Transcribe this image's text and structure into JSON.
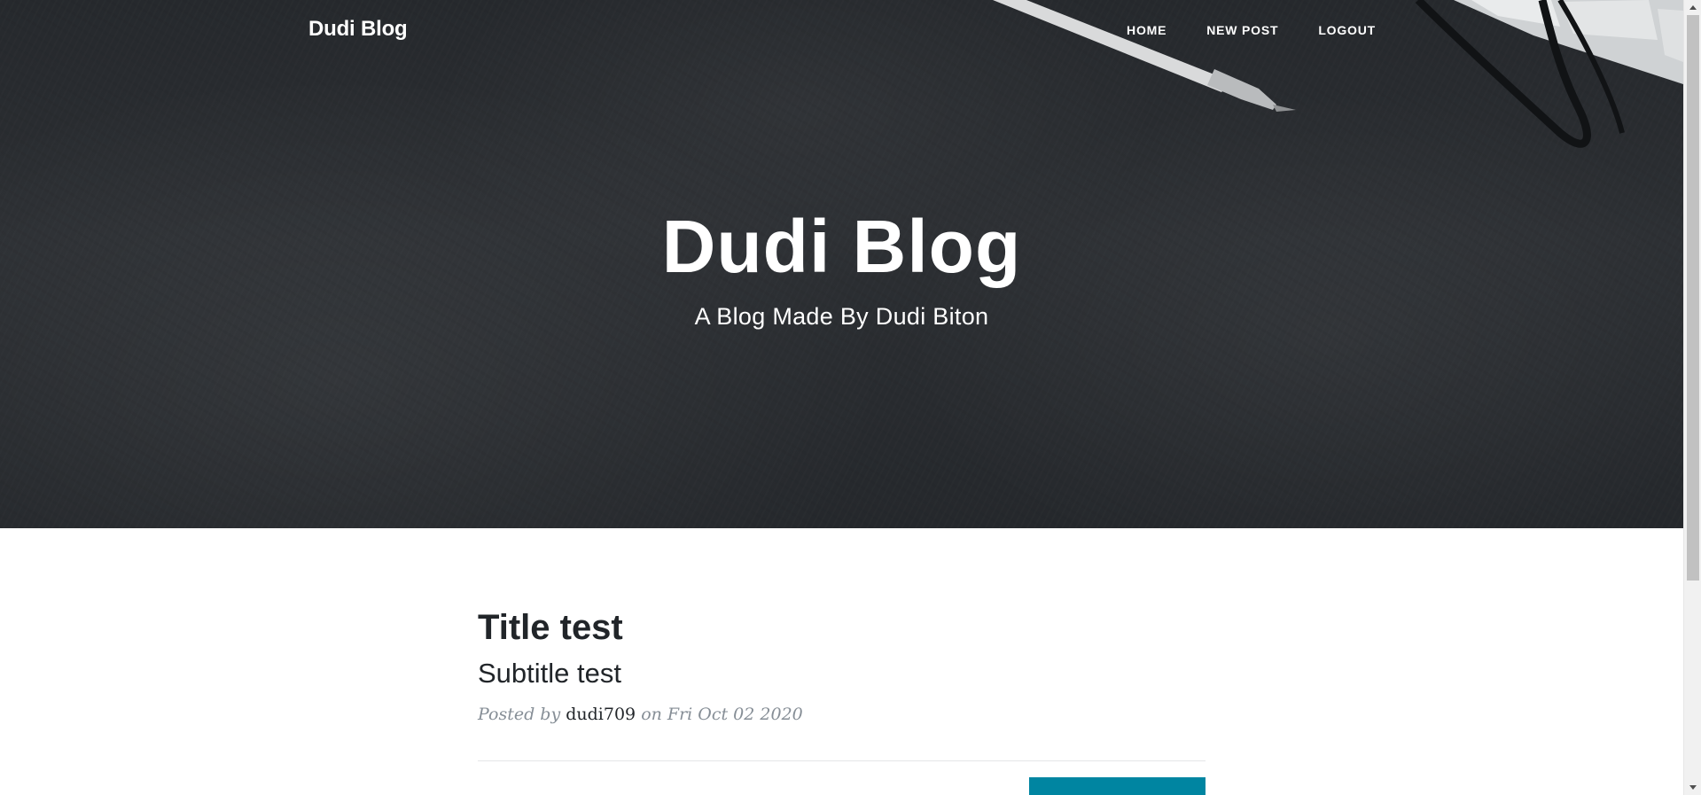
{
  "navbar": {
    "brand": "Dudi Blog",
    "links": [
      {
        "label": "Home"
      },
      {
        "label": "New Post"
      },
      {
        "label": "Logout"
      }
    ]
  },
  "hero": {
    "title": "Dudi Blog",
    "subtitle": "A Blog Made By Dudi Biton"
  },
  "posts": [
    {
      "title": "Title test",
      "subtitle": "Subtitle test",
      "meta_prefix": "Posted by",
      "author": "dudi709",
      "meta_suffix": "on Fri Oct 02 2020"
    }
  ],
  "pager": {
    "older_label": ""
  },
  "icons": {
    "scroll_up": "scroll-up-arrow-icon",
    "scroll_down": "scroll-down-arrow-icon"
  },
  "colors": {
    "hero_bg": "#2a2d31",
    "text_dark": "#212529",
    "meta_gray": "#868e96",
    "button_teal": "#0085a1",
    "white": "#ffffff"
  }
}
